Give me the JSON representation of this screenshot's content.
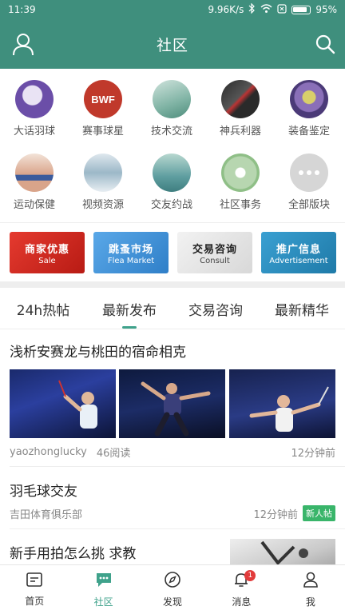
{
  "status_bar": {
    "time": "11:39",
    "network_speed": "9.96K/s",
    "battery": "95%"
  },
  "app_bar": {
    "title": "社区",
    "left_icon": "user-icon",
    "right_icon": "search-icon"
  },
  "boards": [
    {
      "label": "大话羽球",
      "color": "#6b4ea8"
    },
    {
      "label": "赛事球星",
      "color": "#c0392b"
    },
    {
      "label": "技术交流",
      "color": "#7fb3a4"
    },
    {
      "label": "神兵利器",
      "color": "#2a2a2a"
    },
    {
      "label": "装备鉴定",
      "color": "#8a6fb8"
    },
    {
      "label": "运动保健",
      "color": "#d9a48a"
    },
    {
      "label": "视频资源",
      "color": "#9cb8c8"
    },
    {
      "label": "交友约战",
      "color": "#5f9ea0"
    },
    {
      "label": "社区事务",
      "color": "#b7d6b0"
    },
    {
      "label": "全部版块",
      "color": "#d6d6d6"
    }
  ],
  "banners": [
    {
      "cn": "商家优惠",
      "en": "Sale",
      "color": "#d9251d"
    },
    {
      "cn": "跳蚤市场",
      "en": "Flea Market",
      "color": "#3b8ed6"
    },
    {
      "cn": "交易咨询",
      "en": "Consult",
      "color": "#e7e7e7"
    },
    {
      "cn": "推广信息",
      "en": "Advertisement",
      "color": "#2a8fbf"
    }
  ],
  "tabs": [
    "24h热帖",
    "最新发布",
    "交易咨询",
    "最新精华"
  ],
  "active_tab": "最新发布",
  "posts": [
    {
      "title": "浅析安赛龙与桃田的宿命相克",
      "author": "yaozhonglucky",
      "reads": "46阅读",
      "time": "12分钟前"
    },
    {
      "title": "羽毛球交友",
      "author": "吉田体育俱乐部",
      "time": "12分钟前",
      "tag": "新人帖"
    },
    {
      "title": "新手用拍怎么挑 求教"
    }
  ],
  "bottom_nav": [
    {
      "label": "首页",
      "icon": "home-icon"
    },
    {
      "label": "社区",
      "icon": "community-icon"
    },
    {
      "label": "发现",
      "icon": "compass-icon"
    },
    {
      "label": "消息",
      "icon": "bell-icon",
      "badge": "1"
    },
    {
      "label": "我",
      "icon": "profile-icon"
    }
  ],
  "accent_color": "#3f8f7d"
}
